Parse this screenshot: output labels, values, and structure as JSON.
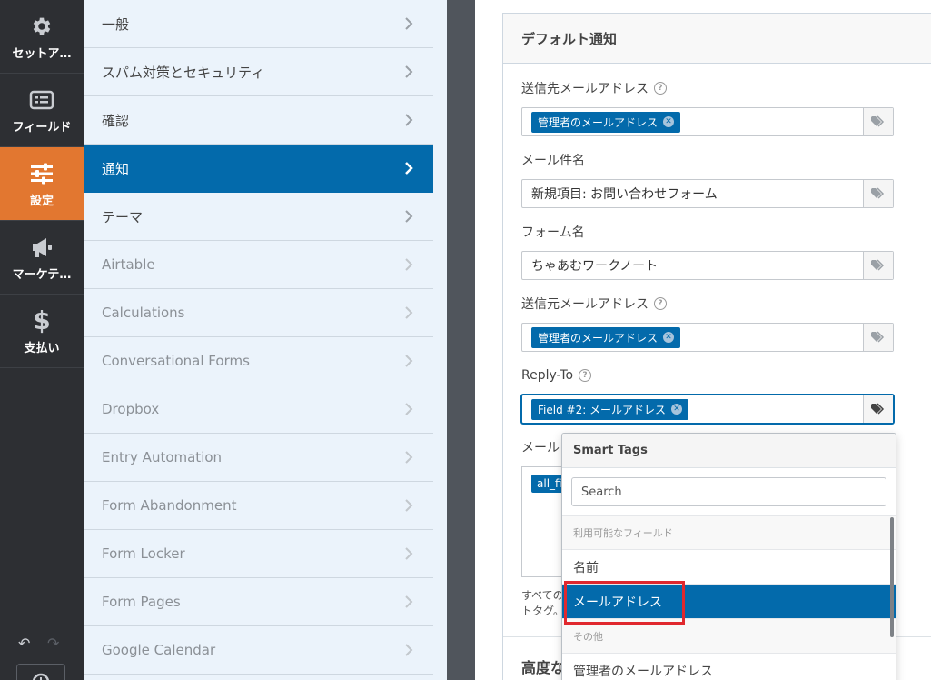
{
  "rail": {
    "items": [
      {
        "label": "セットア…",
        "icon": "gear-icon"
      },
      {
        "label": "フィールド",
        "icon": "fields-list-icon"
      },
      {
        "label": "設定",
        "icon": "sliders-icon",
        "active": true
      },
      {
        "label": "マーケテ…",
        "icon": "megaphone-icon"
      },
      {
        "label": "支払い",
        "icon": "dollar-icon"
      }
    ],
    "undo_icon": "undo-icon",
    "redo_icon": "redo-icon",
    "history_icon": "history-icon"
  },
  "panel": {
    "items": [
      {
        "label": "一般"
      },
      {
        "label": "スパム対策とセキュリティ"
      },
      {
        "label": "確認"
      },
      {
        "label": "通知",
        "active": true
      },
      {
        "label": "テーマ"
      },
      {
        "label": "Airtable"
      },
      {
        "label": "Calculations"
      },
      {
        "label": "Conversational Forms"
      },
      {
        "label": "Dropbox"
      },
      {
        "label": "Entry Automation"
      },
      {
        "label": "Form Abandonment"
      },
      {
        "label": "Form Locker"
      },
      {
        "label": "Form Pages"
      },
      {
        "label": "Google Calendar"
      }
    ]
  },
  "notification": {
    "title": "デフォルト通知",
    "send_to": {
      "label": "送信先メールアドレス",
      "chip": "管理者のメールアドレス"
    },
    "subject": {
      "label": "メール件名",
      "value": "新規項目: お問い合わせフォーム"
    },
    "from_name": {
      "label": "フォーム名",
      "value": "ちゃあむワークノート"
    },
    "from_email": {
      "label": "送信元メールアドレス",
      "chip": "管理者のメールアドレス"
    },
    "reply_to": {
      "label": "Reply-To",
      "chip": "Field #2: メールアドレス"
    },
    "message": {
      "label": "メール",
      "chip": "all_fie"
    },
    "description_line1": "すべての",
    "description_line2": "トタグ。",
    "advanced": "高度な"
  },
  "smart_tags": {
    "title": "Smart Tags",
    "search_placeholder": "Search",
    "section_available": "利用可能なフィールド",
    "items": [
      "名前",
      "メールアドレス"
    ],
    "section_other": "その他",
    "other_items": [
      "管理者のメールアドレス"
    ]
  },
  "colors": {
    "accent": "#036aab",
    "active_rail": "#e27730",
    "highlight": "#e0282e"
  }
}
